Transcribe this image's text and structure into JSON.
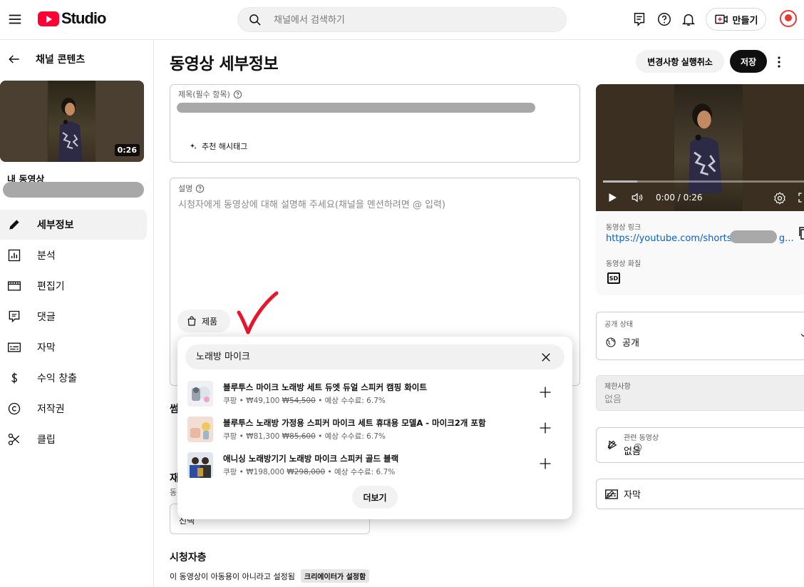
{
  "header": {
    "logo_text": "Studio",
    "search_placeholder": "채널에서 검색하기",
    "create_label": "만들기"
  },
  "sidebar": {
    "back_label": "채널 콘텐츠",
    "thumb_duration": "0:26",
    "my_video_label": "내 동영상",
    "items": [
      {
        "label": "세부정보",
        "icon": "pencil-icon",
        "active": true
      },
      {
        "label": "분석",
        "icon": "analytics-icon"
      },
      {
        "label": "편집기",
        "icon": "editor-icon"
      },
      {
        "label": "댓글",
        "icon": "comments-icon"
      },
      {
        "label": "자막",
        "icon": "subtitles-icon"
      },
      {
        "label": "수익 창출",
        "icon": "dollar-icon"
      },
      {
        "label": "저작권",
        "icon": "copyright-icon"
      },
      {
        "label": "클립",
        "icon": "scissors-icon"
      }
    ]
  },
  "main": {
    "page_title": "동영상 세부정보",
    "undo_label": "변경사항 실행취소",
    "save_label": "저장",
    "title_field_label": "제목(필수 항목)",
    "hashtag_label": "추천 해시태그",
    "desc_field_label": "설명",
    "desc_placeholder": "시청자에게 동영상에 대해 설명해 주세요(채널을 멘션하려면 @ 입력)",
    "product_button_label": "제품",
    "partial_thumb_label": "썸",
    "partial_playlist_label": "재",
    "partial_playlist_sub": "동",
    "partial_select_value": "선택",
    "audience_title": "시청자층",
    "audience_text": "이 동영상이 아동용이 아니라고 설정됨",
    "audience_badge": "크리에이터가 설정함"
  },
  "popup": {
    "search_value": "노래방 마이크",
    "more_label": "더보기",
    "products": [
      {
        "name": "블루투스 마이크 노래방 세트 듀엣 듀얼 스피커 캠핑 화이트",
        "store": "쿠팡",
        "price": "₩49,100",
        "original_price": "₩54,500",
        "commission": "예상 수수료: 6.7%"
      },
      {
        "name": "블루투스 노래방 가정용 스피커 마이크 세트 휴대용 모델A - 마이크2개 포함",
        "store": "쿠팡",
        "price": "₩81,300",
        "original_price": "₩85,600",
        "commission": "예상 수수료: 6.7%"
      },
      {
        "name": "애니싱 노래방기기 노래방 마이크 스피커 골드 블랙",
        "store": "쿠팡",
        "price": "₩198,000",
        "original_price": "₩298,000",
        "commission": "예상 수수료: 6.7%"
      }
    ]
  },
  "right": {
    "player_time": "0:00 / 0:26",
    "link_label": "동영상 링크",
    "link_url": "https://youtube.com/shorts/",
    "link_tail": "g...",
    "quality_label": "동영상 화질",
    "quality_value": "SD",
    "visibility_label": "공개 상태",
    "visibility_value": "공개",
    "restrictions_label": "제한사항",
    "restrictions_value": "없음",
    "related_label": "관련 동영상",
    "related_value": "없음",
    "subtitles_label": "자막"
  },
  "colors": {
    "brand_red": "#ff0033",
    "link_blue": "#065fd4",
    "check_red": "#e8152b"
  }
}
